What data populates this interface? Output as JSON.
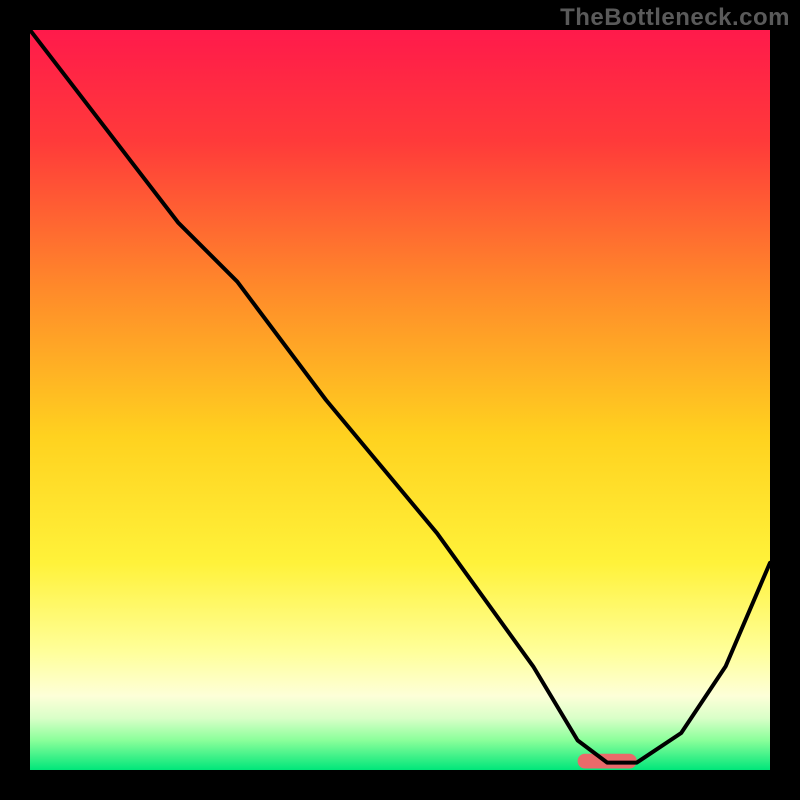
{
  "watermark": "TheBottleneck.com",
  "chart_data": {
    "type": "line",
    "title": "",
    "xlabel": "",
    "ylabel": "",
    "xlim": [
      0,
      100
    ],
    "ylim": [
      0,
      100
    ],
    "grid": false,
    "background_gradient": {
      "stops": [
        {
          "offset": 0,
          "color": "#ff1a4b"
        },
        {
          "offset": 0.15,
          "color": "#ff3a3a"
        },
        {
          "offset": 0.35,
          "color": "#ff8a2a"
        },
        {
          "offset": 0.55,
          "color": "#ffd21f"
        },
        {
          "offset": 0.72,
          "color": "#fff23a"
        },
        {
          "offset": 0.84,
          "color": "#ffff9a"
        },
        {
          "offset": 0.9,
          "color": "#fdffd8"
        },
        {
          "offset": 0.93,
          "color": "#d9ffc8"
        },
        {
          "offset": 0.96,
          "color": "#8aff9a"
        },
        {
          "offset": 1.0,
          "color": "#00e67a"
        }
      ]
    },
    "series": [
      {
        "name": "curve",
        "color": "#000000",
        "x": [
          0,
          10,
          20,
          28,
          40,
          55,
          68,
          74,
          78,
          82,
          88,
          94,
          100
        ],
        "y": [
          100,
          87,
          74,
          66,
          50,
          32,
          14,
          4,
          1,
          1,
          5,
          14,
          28
        ]
      }
    ],
    "marker": {
      "name": "highlight",
      "color": "#e96a6a",
      "x_start": 74,
      "x_end": 82,
      "y": 1.2,
      "thickness": 2
    }
  }
}
